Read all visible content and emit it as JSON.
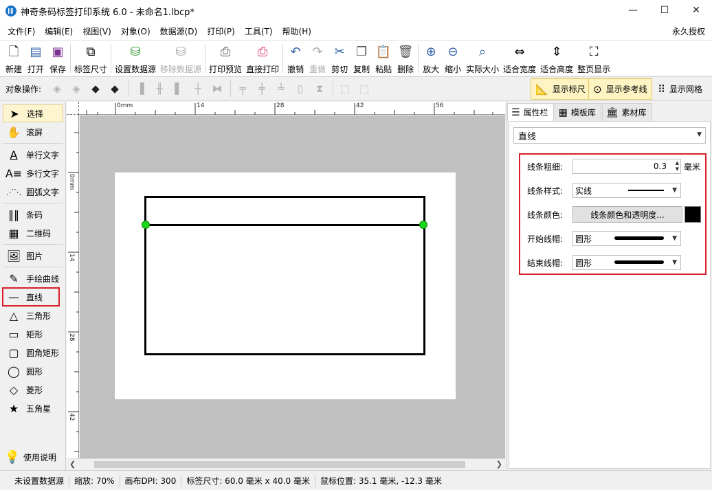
{
  "window": {
    "title": "神奇条码标签打印系统 6.0 - 未命名1.lbcp*",
    "minimize": "—",
    "maximize": "☐",
    "close": "✕"
  },
  "menu": {
    "items": [
      "文件(F)",
      "编辑(E)",
      "视图(V)",
      "对象(O)",
      "数据源(D)",
      "打印(P)",
      "工具(T)",
      "帮助(H)"
    ],
    "license": "永久授权"
  },
  "toolbar": {
    "new": "新建",
    "open": "打开",
    "save": "保存",
    "label_size": "标签尺寸",
    "set_datasource": "设置数据源",
    "remove_datasource": "移除数据源",
    "print_preview": "打印预览",
    "direct_print": "直接打印",
    "undo": "撤销",
    "redo": "重做",
    "cut": "剪切",
    "copy": "复制",
    "paste": "粘贴",
    "delete": "删除",
    "zoom_in": "放大",
    "zoom_out": "缩小",
    "actual_size": "实际大小",
    "fit_width": "适合宽度",
    "fit_height": "适合高度",
    "whole_page": "整页显示"
  },
  "objbar": {
    "label": "对象操作:",
    "show_ruler": "显示标尺",
    "show_guides": "显示参考线",
    "show_grid": "显示网格"
  },
  "tools": {
    "select": "选择",
    "scroll": "滚屏",
    "single_text": "单行文字",
    "multi_text": "多行文字",
    "arc_text": "圆弧文字",
    "barcode": "条码",
    "qrcode": "二维码",
    "image": "图片",
    "freehand": "手绘曲线",
    "line": "直线",
    "triangle": "三角形",
    "rectangle": "矩形",
    "round_rect": "圆角矩形",
    "ellipse": "圆形",
    "diamond": "菱形",
    "star": "五角星",
    "help": "使用说明"
  },
  "ruler": {
    "top": [
      "0mm",
      "14",
      "28",
      "42",
      "56"
    ],
    "left": [
      "0mm",
      "14",
      "28",
      "42"
    ]
  },
  "panel": {
    "tabs": [
      "属性栏",
      "模板库",
      "素材库"
    ],
    "object_type": "直线",
    "line_width_label": "线条粗细:",
    "line_width_value": "0.3",
    "line_width_unit": "毫米",
    "line_style_label": "线条样式:",
    "line_style_value": "实线",
    "line_color_label": "线条颜色:",
    "line_color_button": "线条颜色和透明度...",
    "line_color": "#000000",
    "start_cap_label": "开始线帽:",
    "start_cap_value": "圆形",
    "end_cap_label": "结束线帽:",
    "end_cap_value": "圆形"
  },
  "status": {
    "datasource": "未设置数据源",
    "zoom": "缩放: 70%",
    "dpi": "画布DPI: 300",
    "label_size": "标签尺寸: 60.0 毫米 x 40.0 毫米",
    "mouse_pos": "鼠标位置: 35.1 毫米, -12.3 毫米"
  }
}
